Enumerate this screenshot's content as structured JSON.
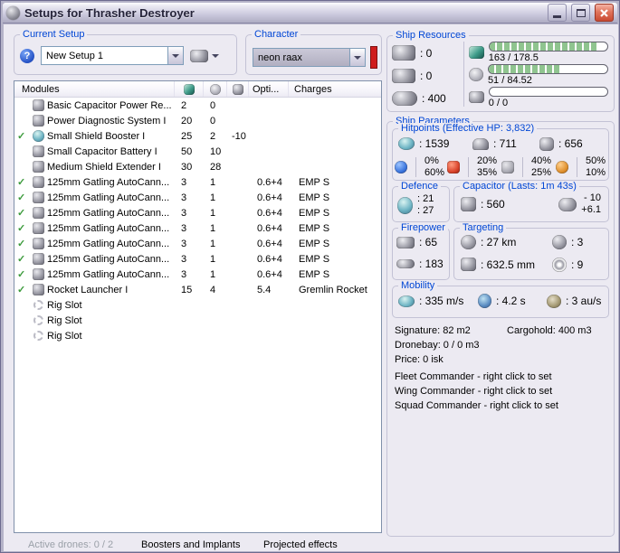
{
  "colors": {
    "accent_blue": "#0046d5",
    "check_green": "#3c9b3c",
    "bar_green": "#8fc48f",
    "unsaved_red": "#cf1d1d"
  },
  "window": {
    "title": "Setups for Thrasher Destroyer"
  },
  "setup": {
    "group_label": "Current Setup",
    "selected": "New Setup 1",
    "help_glyph": "?"
  },
  "character": {
    "group_label": "Character",
    "selected": "neon raax"
  },
  "modules": {
    "header": {
      "name": "Modules",
      "opti": "Opti...",
      "charges": "Charges"
    },
    "rows": [
      {
        "check": "",
        "name": "Basic Capacitor Power Re...",
        "cpu": "2",
        "pg": "0",
        "cap": "",
        "opti": "",
        "charges": ""
      },
      {
        "check": "",
        "name": "Power Diagnostic System I",
        "cpu": "20",
        "pg": "0",
        "cap": "",
        "opti": "",
        "charges": ""
      },
      {
        "check": "✓",
        "name": "Small Shield Booster I",
        "cpu": "25",
        "pg": "2",
        "cap": "-10",
        "opti": "",
        "charges": ""
      },
      {
        "check": "",
        "name": "Small Capacitor Battery I",
        "cpu": "50",
        "pg": "10",
        "cap": "",
        "opti": "",
        "charges": ""
      },
      {
        "check": "",
        "name": "Medium Shield Extender I",
        "cpu": "30",
        "pg": "28",
        "cap": "",
        "opti": "",
        "charges": ""
      },
      {
        "check": "✓",
        "name": "125mm Gatling AutoCann...",
        "cpu": "3",
        "pg": "1",
        "cap": "",
        "opti": "0.6+4",
        "charges": "EMP S"
      },
      {
        "check": "✓",
        "name": "125mm Gatling AutoCann...",
        "cpu": "3",
        "pg": "1",
        "cap": "",
        "opti": "0.6+4",
        "charges": "EMP S"
      },
      {
        "check": "✓",
        "name": "125mm Gatling AutoCann...",
        "cpu": "3",
        "pg": "1",
        "cap": "",
        "opti": "0.6+4",
        "charges": "EMP S"
      },
      {
        "check": "✓",
        "name": "125mm Gatling AutoCann...",
        "cpu": "3",
        "pg": "1",
        "cap": "",
        "opti": "0.6+4",
        "charges": "EMP S"
      },
      {
        "check": "✓",
        "name": "125mm Gatling AutoCann...",
        "cpu": "3",
        "pg": "1",
        "cap": "",
        "opti": "0.6+4",
        "charges": "EMP S"
      },
      {
        "check": "✓",
        "name": "125mm Gatling AutoCann...",
        "cpu": "3",
        "pg": "1",
        "cap": "",
        "opti": "0.6+4",
        "charges": "EMP S"
      },
      {
        "check": "✓",
        "name": "125mm Gatling AutoCann...",
        "cpu": "3",
        "pg": "1",
        "cap": "",
        "opti": "0.6+4",
        "charges": "EMP S"
      },
      {
        "check": "✓",
        "name": "Rocket Launcher I",
        "cpu": "15",
        "pg": "4",
        "cap": "",
        "opti": "5.4",
        "charges": "Gremlin Rocket"
      },
      {
        "check": "",
        "name": "Rig Slot",
        "cpu": "",
        "pg": "",
        "cap": "",
        "opti": "",
        "charges": ""
      },
      {
        "check": "",
        "name": "Rig Slot",
        "cpu": "",
        "pg": "",
        "cap": "",
        "opti": "",
        "charges": ""
      },
      {
        "check": "",
        "name": "Rig Slot",
        "cpu": "",
        "pg": "",
        "cap": "",
        "opti": "",
        "charges": ""
      }
    ]
  },
  "footer": {
    "active_drones": "Active drones: 0 / 2",
    "boosters_implants": "Boosters and Implants",
    "projected_effects": "Projected effects"
  },
  "resources": {
    "group_label": "Ship Resources",
    "turrets": ": 0",
    "launchers": ": 0",
    "calibration": ": 400",
    "cpu": {
      "text": "163 / 178.5",
      "pct": 91
    },
    "powergrid": {
      "text": "51 / 84.52",
      "pct": 60
    },
    "rig": {
      "text": "0 / 0",
      "pct": 0
    }
  },
  "parameters": {
    "group_label": "Ship Parameters",
    "hitpoints": {
      "group_label": "Hitpoints (Effective HP: 3,832)",
      "shield": ": 1539",
      "armor": ": 711",
      "structure": ": 656",
      "resists": [
        {
          "top": "0%",
          "bottom": "60%"
        },
        {
          "top": "20%",
          "bottom": "35%"
        },
        {
          "top": "40%",
          "bottom": "25%"
        },
        {
          "top": "50%",
          "bottom": "10%"
        }
      ]
    },
    "defence": {
      "group_label": "Defence",
      "top": ": 21",
      "bottom": ": 27"
    },
    "capacitor": {
      "group_label": "Capacitor (Lasts: 1m 43s)",
      "amount": ": 560",
      "delta_top": "- 10",
      "delta_bottom": "+6.1"
    },
    "firepower": {
      "group_label": "Firepower",
      "dps": ": 65",
      "volley": ": 183"
    },
    "targeting": {
      "group_label": "Targeting",
      "range": ": 27 km",
      "max_targets": ": 3",
      "resolution": ": 632.5 mm",
      "sensor_strength": ": 9"
    },
    "mobility": {
      "group_label": "Mobility",
      "speed": ": 335 m/s",
      "agility": ": 4.2 s",
      "warp": ": 3 au/s"
    },
    "stats": {
      "signature": "Signature: 82 m2",
      "cargohold": "Cargohold: 400 m3",
      "dronebay": "Dronebay: 0 / 0 m3",
      "price": "Price: 0 isk",
      "fleet": "Fleet Commander - right click to set",
      "wing": "Wing Commander - right click to set",
      "squad": "Squad Commander - right click to set"
    }
  }
}
